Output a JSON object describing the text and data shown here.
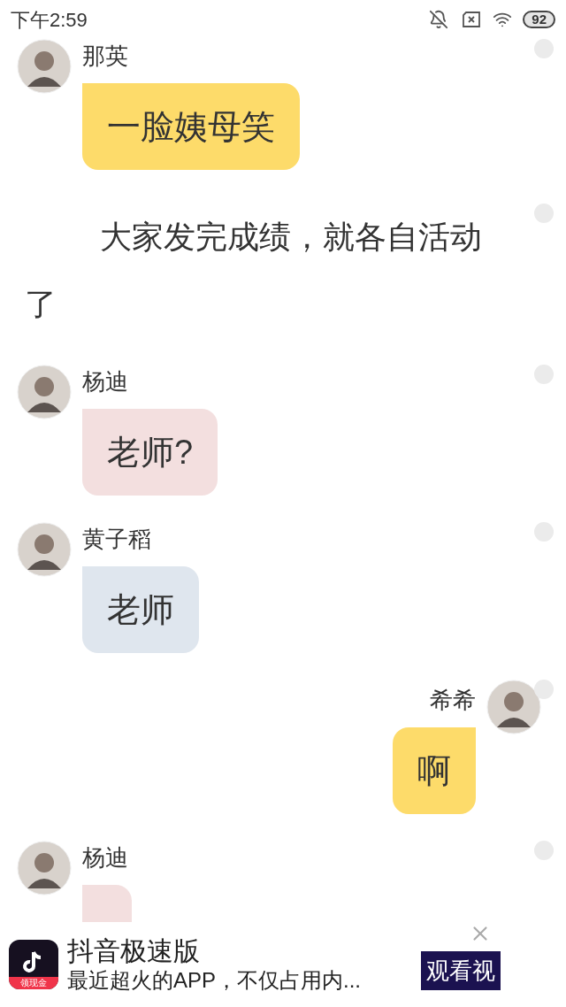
{
  "status_bar": {
    "time": "下午2:59",
    "battery": "92"
  },
  "messages": [
    {
      "kind": "left",
      "sender": "那英",
      "text": "一脸姨母笑",
      "color": "#fddb6a"
    },
    {
      "kind": "narration",
      "text": "大家发完成绩，就各自活动了"
    },
    {
      "kind": "left",
      "sender": "杨迪",
      "text": "老师?",
      "color": "#f3dfdf"
    },
    {
      "kind": "left",
      "sender": "黄子稻",
      "text": "老师",
      "color": "#dfe6ee"
    },
    {
      "kind": "right",
      "sender": "希希",
      "text": "啊",
      "color": "#fddb6a"
    },
    {
      "kind": "left",
      "sender": "杨迪",
      "color": "#f3dfdf"
    }
  ],
  "ad": {
    "title": "抖音极速版",
    "description": "最近超火的APP，不仅占用内...",
    "badge": "领现金",
    "action": "观看视"
  }
}
